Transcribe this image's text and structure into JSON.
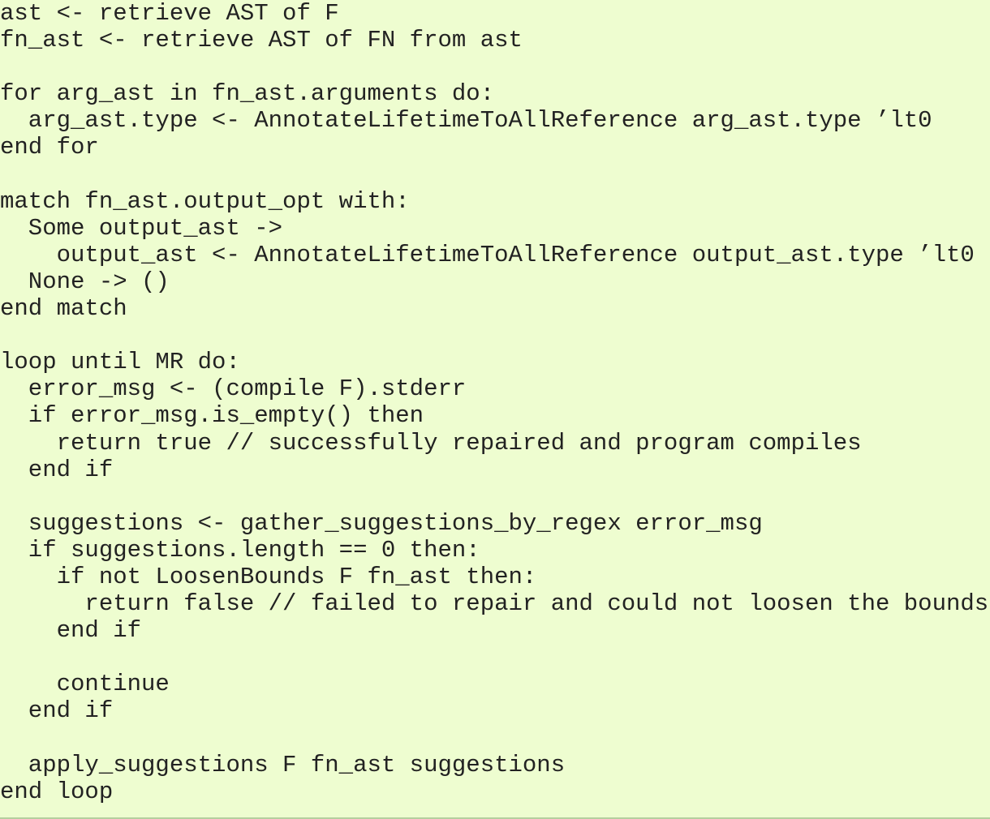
{
  "code_block": {
    "lines": [
      "ast <- retrieve AST of F",
      "fn_ast <- retrieve AST of FN from ast",
      "",
      "for arg_ast in fn_ast.arguments do:",
      "  arg_ast.type <- AnnotateLifetimeToAllReference arg_ast.type ’lt0",
      "end for",
      "",
      "match fn_ast.output_opt with:",
      "  Some output_ast ->",
      "    output_ast <- AnnotateLifetimeToAllReference output_ast.type ’lt0",
      "  None -> ()",
      "end match",
      "",
      "loop until MR do:",
      "  error_msg <- (compile F).stderr",
      "  if error_msg.is_empty() then",
      "    return true // successfully repaired and program compiles",
      "  end if",
      "",
      "  suggestions <- gather_suggestions_by_regex error_msg",
      "  if suggestions.length == 0 then:",
      "    if not LoosenBounds F fn_ast then:",
      "      return false // failed to repair and could not loosen the bounds",
      "    end if",
      "",
      "    continue",
      "  end if",
      "",
      "  apply_suggestions F fn_ast suggestions",
      "end loop"
    ]
  },
  "colors": {
    "background": "#eefdd0",
    "text": "#222222",
    "rule": "#b5cf9e"
  }
}
